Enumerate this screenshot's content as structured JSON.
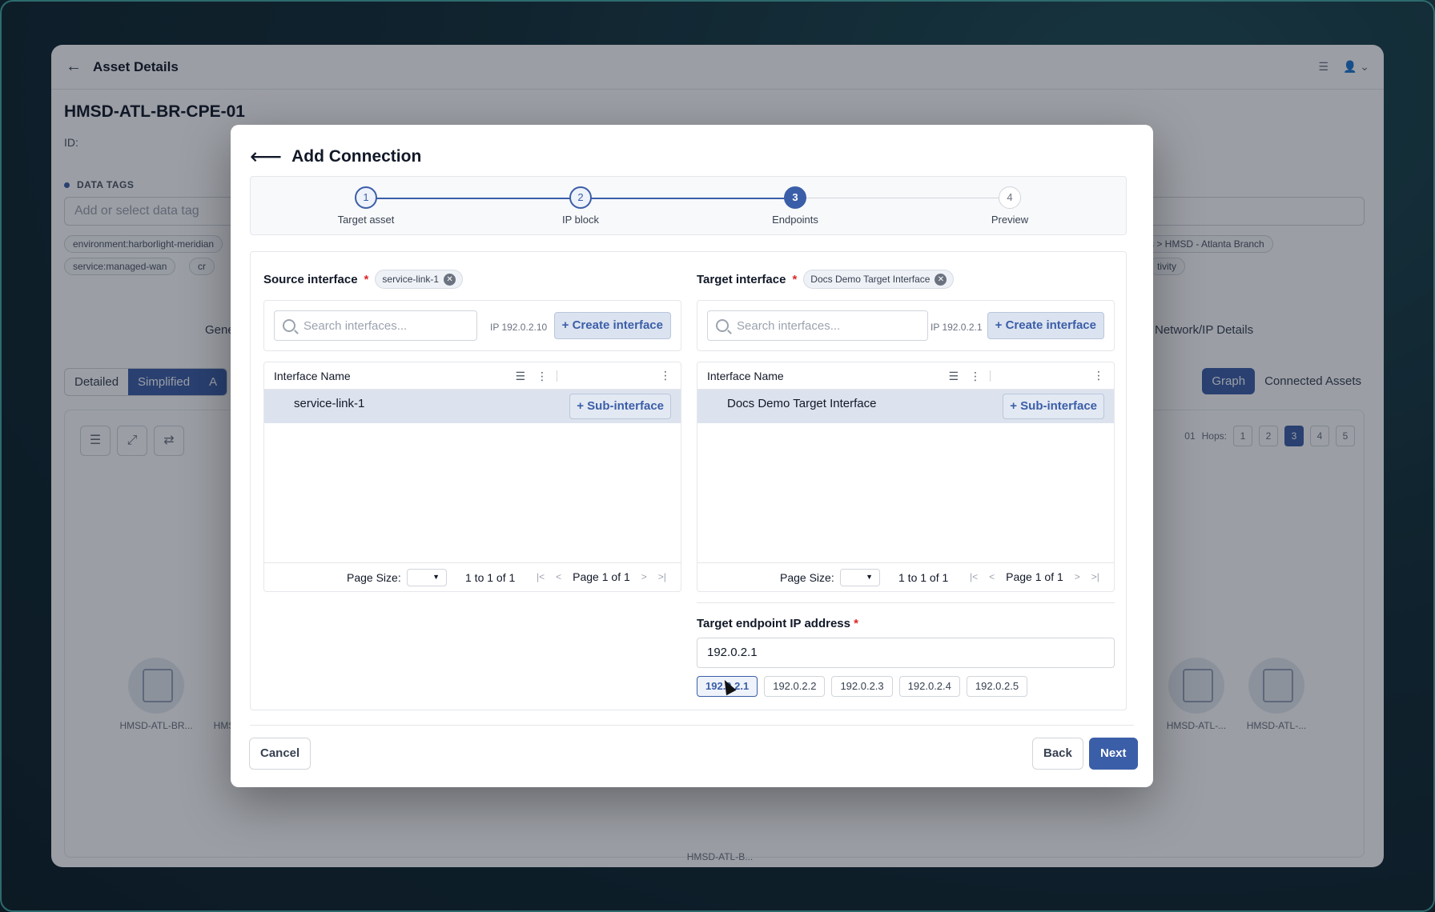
{
  "background": {
    "header_title": "Asset Details",
    "asset_name": "HMSD-ATL-BR-CPE-01",
    "asset_id_label": "ID:",
    "data_tags_label": "DATA TAGS",
    "tag_input_placeholder": "Add or select data tag",
    "tags": [
      "environment:harborlight-meridian",
      "service:managed-wan",
      "cr",
      "s > HMSD - Atlanta Branch",
      "tivity"
    ],
    "tabs": [
      "Gene",
      "Network/IP Details"
    ],
    "view_toggle": [
      "Detailed",
      "Simplified",
      "A"
    ],
    "graph_toggle": [
      "Graph",
      "Connected Assets"
    ],
    "hops_label": "Hops:",
    "hops": [
      "1",
      "2",
      "3",
      "4",
      "5"
    ],
    "hops_prefix": "01",
    "nodes": [
      "HMSD-ATL-BR...",
      "HMS",
      "HMSD-ATL-B...",
      "HMSD-ATL-...",
      "HMSD-ATL-..."
    ]
  },
  "modal": {
    "title": "Add Connection",
    "steps": [
      {
        "num": "1",
        "label": "Target asset",
        "state": "done"
      },
      {
        "num": "2",
        "label": "IP block",
        "state": "done"
      },
      {
        "num": "3",
        "label": "Endpoints",
        "state": "active"
      },
      {
        "num": "4",
        "label": "Preview",
        "state": "pending"
      }
    ],
    "source": {
      "label": "Source interface",
      "selected": "service-link-1",
      "search_placeholder": "Search interfaces...",
      "ip_hint": "IP 192.0.2.10",
      "create_label": "+ Create interface",
      "column": "Interface Name",
      "rows": [
        {
          "name": "service-link-1",
          "action": "+ Sub-interface"
        }
      ],
      "page_size_label": "Page Size:",
      "count": "1 to 1 of 1",
      "page": "Page 1 of 1"
    },
    "target": {
      "label": "Target interface",
      "selected": "Docs Demo Target Interface",
      "search_placeholder": "Search interfaces...",
      "ip_hint": "IP 192.0.2.1",
      "create_label": "+ Create interface",
      "column": "Interface Name",
      "rows": [
        {
          "name": "Docs Demo Target Interface",
          "action": "+ Sub-interface"
        }
      ],
      "page_size_label": "Page Size:",
      "count": "1 to 1 of 1",
      "page": "Page 1 of 1"
    },
    "target_ip": {
      "label": "Target endpoint IP address",
      "value": "192.0.2.1",
      "options": [
        "192.0.2.1",
        "192.0.2.2",
        "192.0.2.3",
        "192.0.2.4",
        "192.0.2.5"
      ],
      "selected_index": 0
    },
    "buttons": {
      "cancel": "Cancel",
      "back": "Back",
      "next": "Next"
    },
    "accent_color": "#3b5ea8"
  }
}
